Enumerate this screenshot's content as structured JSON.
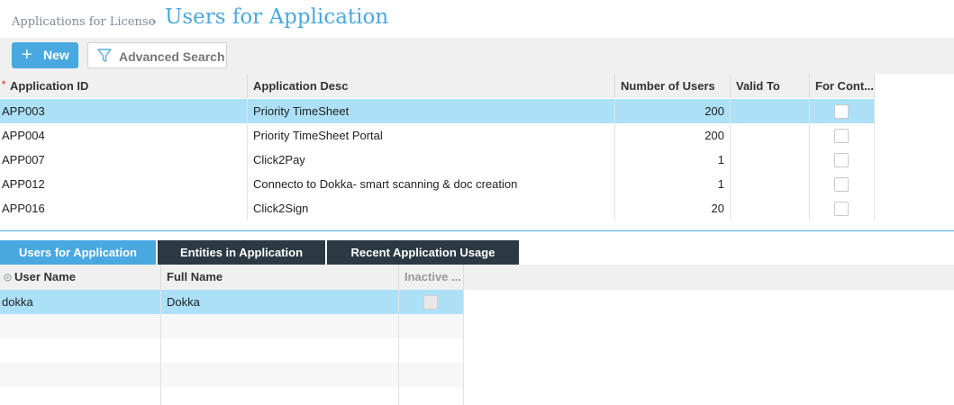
{
  "breadcrumb": {
    "parent": "Applications for License",
    "separator": "›"
  },
  "page": {
    "title": "Users for Application"
  },
  "toolbar": {
    "new_label": "New",
    "advanced_search_label": "Advanced Search"
  },
  "main_grid": {
    "columns": [
      "Application ID",
      "Application Desc",
      "Number of Users",
      "Valid To",
      "For Cont..."
    ],
    "rows": [
      {
        "id": "APP003",
        "desc": "Priority TimeSheet",
        "users": "200",
        "valid_to": "",
        "for_cont": false
      },
      {
        "id": "APP004",
        "desc": "Priority TimeSheet Portal",
        "users": "200",
        "valid_to": "",
        "for_cont": false
      },
      {
        "id": "APP007",
        "desc": "Click2Pay",
        "users": "1",
        "valid_to": "",
        "for_cont": false
      },
      {
        "id": "APP012",
        "desc": "Connecto to Dokka- smart scanning & doc creation",
        "users": "1",
        "valid_to": "",
        "for_cont": false
      },
      {
        "id": "APP016",
        "desc": "Click2Sign",
        "users": "20",
        "valid_to": "",
        "for_cont": false
      }
    ]
  },
  "tabs": [
    {
      "label": "Users for Application",
      "active": true
    },
    {
      "label": "Entities in Application",
      "active": false
    },
    {
      "label": "Recent Application Usage",
      "active": false
    }
  ],
  "sub_grid": {
    "columns": [
      "User Name",
      "Full Name",
      "Inactive ..."
    ],
    "rows": [
      {
        "user": "dokka",
        "full_name": "Dokka",
        "inactive": false
      }
    ]
  },
  "colors": {
    "accent": "#4aa8e0",
    "selected_row": "#ace0f7",
    "dark_tab": "#2b3a42"
  }
}
